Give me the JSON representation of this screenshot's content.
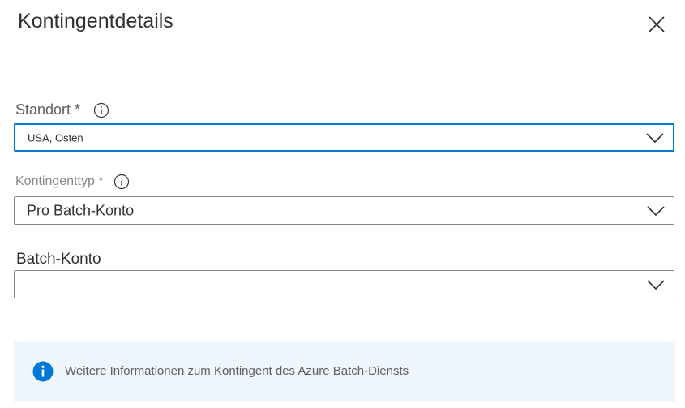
{
  "panel": {
    "title": "Kontingentdetails"
  },
  "fields": {
    "location": {
      "label": "Standort *",
      "value": "USA, Osten"
    },
    "quota_type": {
      "label": "Kontingenttyp *",
      "value": "Pro Batch-Konto"
    },
    "batch_account": {
      "label": "Batch-Konto",
      "value": ""
    }
  },
  "info_bar": {
    "text": "Weitere Informationen zum Kontingent des Azure Batch-Diensts"
  },
  "colors": {
    "accent": "#0078d4",
    "info_bg": "#eff6fc",
    "border": "#8a8886"
  },
  "icons": {
    "close": "close-icon",
    "info": "info-circle-icon",
    "chevron": "chevron-down-icon",
    "info_filled": "info-filled-icon"
  }
}
